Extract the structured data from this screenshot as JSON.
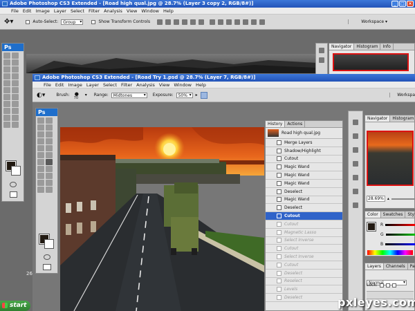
{
  "back_window": {
    "title": "Adobe Photoshop CS3 Extended - [Road high qual.jpg @ 28.7% (Layer 3 copy 2, RGB/8#)]",
    "menu": [
      "File",
      "Edit",
      "Image",
      "Layer",
      "Select",
      "Filter",
      "Analysis",
      "View",
      "Window",
      "Help"
    ],
    "options": {
      "auto_select_label": "Auto-Select:",
      "auto_select_value": "Group",
      "show_transform_label": "Show Transform Controls",
      "workspace_label": "Workspace"
    },
    "navigator_tabs": [
      "Navigator",
      "Histogram",
      "Info"
    ],
    "ps_logo": "Ps"
  },
  "front_window": {
    "title": "Adobe Photoshop CS3 Extended - [Road Try 1.psd @ 28.7% (Layer 7, RGB/8#)]",
    "menu": [
      "File",
      "Edit",
      "Image",
      "Layer",
      "Select",
      "Filter",
      "Analysis",
      "View",
      "Window",
      "Help"
    ],
    "options": {
      "brush_label": "Brush:",
      "brush_size": "70",
      "range_label": "Range:",
      "range_value": "Midtones",
      "exposure_label": "Exposure:",
      "exposure_value": "50%",
      "workspace_label": "Workspa"
    },
    "ps_logo": "Ps",
    "history": {
      "tabs": [
        "History",
        "Actions"
      ],
      "snapshot": "Road high qual.jpg",
      "items": [
        {
          "label": "Merge Layers",
          "state": "normal"
        },
        {
          "label": "Shadow/Highlight",
          "state": "normal"
        },
        {
          "label": "Cutout",
          "state": "normal"
        },
        {
          "label": "Magic Wand",
          "state": "normal"
        },
        {
          "label": "Magic Wand",
          "state": "normal"
        },
        {
          "label": "Magic Wand",
          "state": "normal"
        },
        {
          "label": "Deselect",
          "state": "normal"
        },
        {
          "label": "Magic Wand",
          "state": "normal"
        },
        {
          "label": "Deselect",
          "state": "normal"
        },
        {
          "label": "Cutout",
          "state": "selected"
        },
        {
          "label": "Cutout",
          "state": "dim"
        },
        {
          "label": "Magnetic Lasso",
          "state": "dim"
        },
        {
          "label": "Select Inverse",
          "state": "dim"
        },
        {
          "label": "Cutout",
          "state": "dim"
        },
        {
          "label": "Select Inverse",
          "state": "dim"
        },
        {
          "label": "Cutout",
          "state": "dim"
        },
        {
          "label": "Deselect",
          "state": "dim"
        },
        {
          "label": "Reselect",
          "state": "dim"
        },
        {
          "label": "Levels",
          "state": "dim"
        },
        {
          "label": "Deselect",
          "state": "dim"
        }
      ]
    },
    "navigator": {
      "tabs": [
        "Navigator",
        "Histogram"
      ],
      "zoom": "28.69%"
    },
    "color_panel": {
      "tabs": [
        "Color",
        "Swatches",
        "Sty"
      ],
      "channels": [
        "R",
        "G",
        "B"
      ]
    },
    "layers_panel": {
      "tabs": [
        "Layers",
        "Channels",
        "Pa"
      ],
      "blend_mode": "Normal",
      "lock_label": "Lock:"
    }
  },
  "taskbar": {
    "start_label": "start"
  },
  "side_number": "26",
  "watermark": "pxleyes.com",
  "colors": {
    "title_blue": "#2a5fc4",
    "selection_blue": "#2f63c9",
    "sky_orange": "#e0581a",
    "start_green": "#3a913a"
  }
}
